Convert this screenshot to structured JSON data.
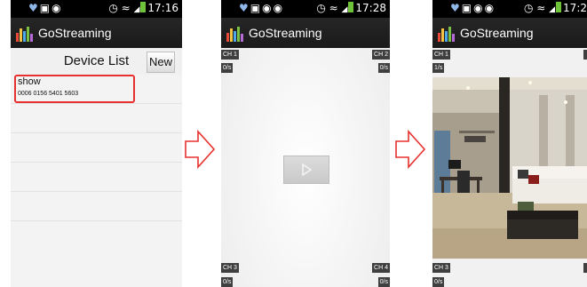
{
  "colors": {
    "highlight": "#e8312f",
    "status_bg": "#000000",
    "appbar_bg": "#1f1f1f",
    "battery": "#6fc33b"
  },
  "phone1": {
    "status": {
      "left_icons": [
        "heart-icon",
        "image-icon",
        "chat-icon"
      ],
      "time": "17:16"
    },
    "app_title": "GoStreaming",
    "header_title": "Device List",
    "new_button": "New",
    "devices": [
      {
        "name": "show",
        "id": "0006 0156 5401 5603"
      }
    ]
  },
  "phone2": {
    "status": {
      "time": "17:28"
    },
    "app_title": "GoStreaming",
    "channels": [
      {
        "label": "CH 1",
        "rate": "0/s"
      },
      {
        "label": "CH 2",
        "rate": "0/s"
      },
      {
        "label": "CH 3",
        "rate": "0/s"
      },
      {
        "label": "CH 4",
        "rate": "0/s"
      }
    ]
  },
  "phone3": {
    "status": {
      "time": "17:2"
    },
    "app_title": "GoStreaming",
    "channels": [
      {
        "label": "CH 1",
        "rate": "1/s"
      },
      {
        "label": "CH 3",
        "rate": "0/s"
      }
    ]
  }
}
